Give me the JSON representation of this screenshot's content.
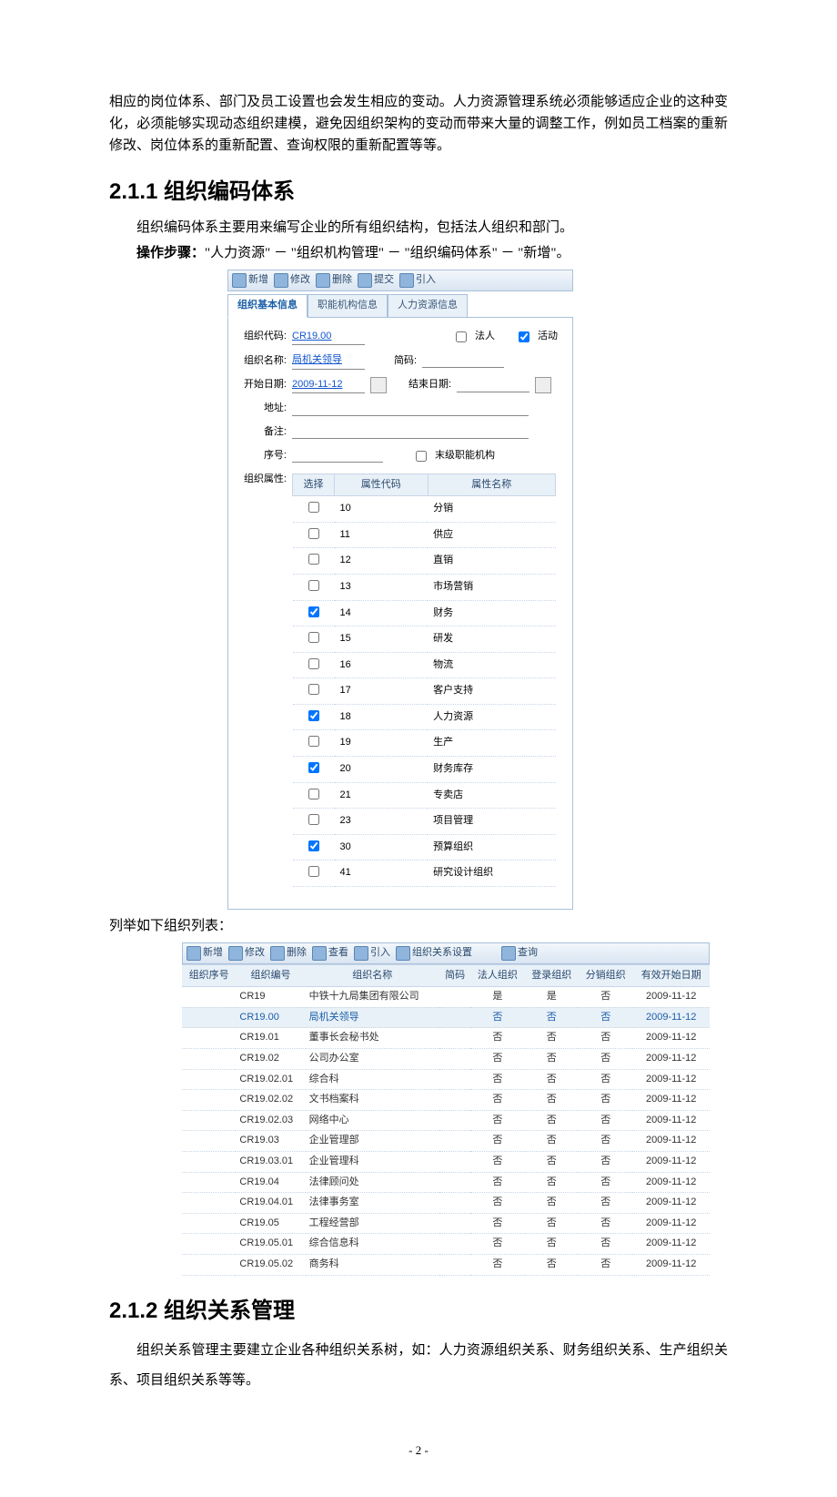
{
  "para_intro": "相应的岗位体系、部门及员工设置也会发生相应的变动。人力资源管理系统必须能够适应企业的这种变化，必须能够实现动态组织建模，避免因组织架构的变动而带来大量的调整工作，例如员工档案的重新修改、岗位体系的重新配置、查询权限的重新配置等等。",
  "h211": "2.1.1 组织编码体系",
  "p211a": "组织编码体系主要用来编写企业的所有组织结构，包括法人组织和部门。",
  "p211b_label": "操作步骤：",
  "p211b_text": "\"人力资源\" － \"组织机构管理\" － \"组织编码体系\" － \"新增\"。",
  "toolbar1": {
    "b1": "新增",
    "b2": "修改",
    "b3": "删除",
    "b4": "提交",
    "b5": "引入"
  },
  "tabs": {
    "t1": "组织基本信息",
    "t2": "职能机构信息",
    "t3": "人力资源信息"
  },
  "form": {
    "l_code": "组织代码:",
    "v_code": "CR19.00",
    "l_legal": "法人",
    "l_active": "活动",
    "l_name": "组织名称:",
    "v_name": "局机关领导",
    "l_abbr": "简码:",
    "l_start": "开始日期:",
    "v_start": "2009-11-12",
    "l_end": "结束日期:",
    "l_addr": "地址:",
    "l_remark": "备注:",
    "l_seq": "序号:",
    "l_leaf": "末级职能机构",
    "l_attr": "组织属性:",
    "th_sel": "选择",
    "th_code": "属性代码",
    "th_name": "属性名称"
  },
  "attr_rows": [
    {
      "code": "10",
      "name": "分销",
      "chk": false
    },
    {
      "code": "11",
      "name": "供应",
      "chk": false
    },
    {
      "code": "12",
      "name": "直销",
      "chk": false
    },
    {
      "code": "13",
      "name": "市场营销",
      "chk": false
    },
    {
      "code": "14",
      "name": "财务",
      "chk": true
    },
    {
      "code": "15",
      "name": "研发",
      "chk": false
    },
    {
      "code": "16",
      "name": "物流",
      "chk": false
    },
    {
      "code": "17",
      "name": "客户支持",
      "chk": false
    },
    {
      "code": "18",
      "name": "人力资源",
      "chk": true
    },
    {
      "code": "19",
      "name": "生产",
      "chk": false
    },
    {
      "code": "20",
      "name": "财务库存",
      "chk": true
    },
    {
      "code": "21",
      "name": "专卖店",
      "chk": false
    },
    {
      "code": "23",
      "name": "项目管理",
      "chk": false
    },
    {
      "code": "30",
      "name": "预算组织",
      "chk": true
    },
    {
      "code": "41",
      "name": "研究设计组织",
      "chk": false
    }
  ],
  "p_list_intro": "列举如下组织列表：",
  "toolbar2": {
    "b1": "新增",
    "b2": "修改",
    "b3": "删除",
    "b4": "查看",
    "b5": "引入",
    "b6": "组织关系设置",
    "b7": "查询"
  },
  "list_headers": {
    "h1": "组织序号",
    "h2": "组织编号",
    "h3": "组织名称",
    "h4": "简码",
    "h5": "法人组织",
    "h6": "登录组织",
    "h7": "分销组织",
    "h8": "有效开始日期"
  },
  "list_rows": [
    {
      "seq": "",
      "code": "CR19",
      "name": "中铁十九局集团有限公司",
      "abbr": "",
      "legal": "是",
      "login": "是",
      "dist": "否",
      "date": "2009-11-12",
      "sel": false
    },
    {
      "seq": "",
      "code": "CR19.00",
      "name": "局机关领导",
      "abbr": "",
      "legal": "否",
      "login": "否",
      "dist": "否",
      "date": "2009-11-12",
      "sel": true
    },
    {
      "seq": "",
      "code": "CR19.01",
      "name": "董事长会秘书处",
      "abbr": "",
      "legal": "否",
      "login": "否",
      "dist": "否",
      "date": "2009-11-12",
      "sel": false
    },
    {
      "seq": "",
      "code": "CR19.02",
      "name": "公司办公室",
      "abbr": "",
      "legal": "否",
      "login": "否",
      "dist": "否",
      "date": "2009-11-12",
      "sel": false
    },
    {
      "seq": "",
      "code": "CR19.02.01",
      "name": "综合科",
      "abbr": "",
      "legal": "否",
      "login": "否",
      "dist": "否",
      "date": "2009-11-12",
      "sel": false
    },
    {
      "seq": "",
      "code": "CR19.02.02",
      "name": "文书档案科",
      "abbr": "",
      "legal": "否",
      "login": "否",
      "dist": "否",
      "date": "2009-11-12",
      "sel": false
    },
    {
      "seq": "",
      "code": "CR19.02.03",
      "name": "网络中心",
      "abbr": "",
      "legal": "否",
      "login": "否",
      "dist": "否",
      "date": "2009-11-12",
      "sel": false
    },
    {
      "seq": "",
      "code": "CR19.03",
      "name": "企业管理部",
      "abbr": "",
      "legal": "否",
      "login": "否",
      "dist": "否",
      "date": "2009-11-12",
      "sel": false
    },
    {
      "seq": "",
      "code": "CR19.03.01",
      "name": "企业管理科",
      "abbr": "",
      "legal": "否",
      "login": "否",
      "dist": "否",
      "date": "2009-11-12",
      "sel": false
    },
    {
      "seq": "",
      "code": "CR19.04",
      "name": "法律顾问处",
      "abbr": "",
      "legal": "否",
      "login": "否",
      "dist": "否",
      "date": "2009-11-12",
      "sel": false
    },
    {
      "seq": "",
      "code": "CR19.04.01",
      "name": "法律事务室",
      "abbr": "",
      "legal": "否",
      "login": "否",
      "dist": "否",
      "date": "2009-11-12",
      "sel": false
    },
    {
      "seq": "",
      "code": "CR19.05",
      "name": "工程经营部",
      "abbr": "",
      "legal": "否",
      "login": "否",
      "dist": "否",
      "date": "2009-11-12",
      "sel": false
    },
    {
      "seq": "",
      "code": "CR19.05.01",
      "name": "综合信息科",
      "abbr": "",
      "legal": "否",
      "login": "否",
      "dist": "否",
      "date": "2009-11-12",
      "sel": false
    },
    {
      "seq": "",
      "code": "CR19.05.02",
      "name": "商务科",
      "abbr": "",
      "legal": "否",
      "login": "否",
      "dist": "否",
      "date": "2009-11-12",
      "sel": false
    }
  ],
  "h212": "2.1.2 组织关系管理",
  "p212": "组织关系管理主要建立企业各种组织关系树，如：人力资源组织关系、财务组织关系、生产组织关系、项目组织关系等等。",
  "footer": "- 2 -"
}
